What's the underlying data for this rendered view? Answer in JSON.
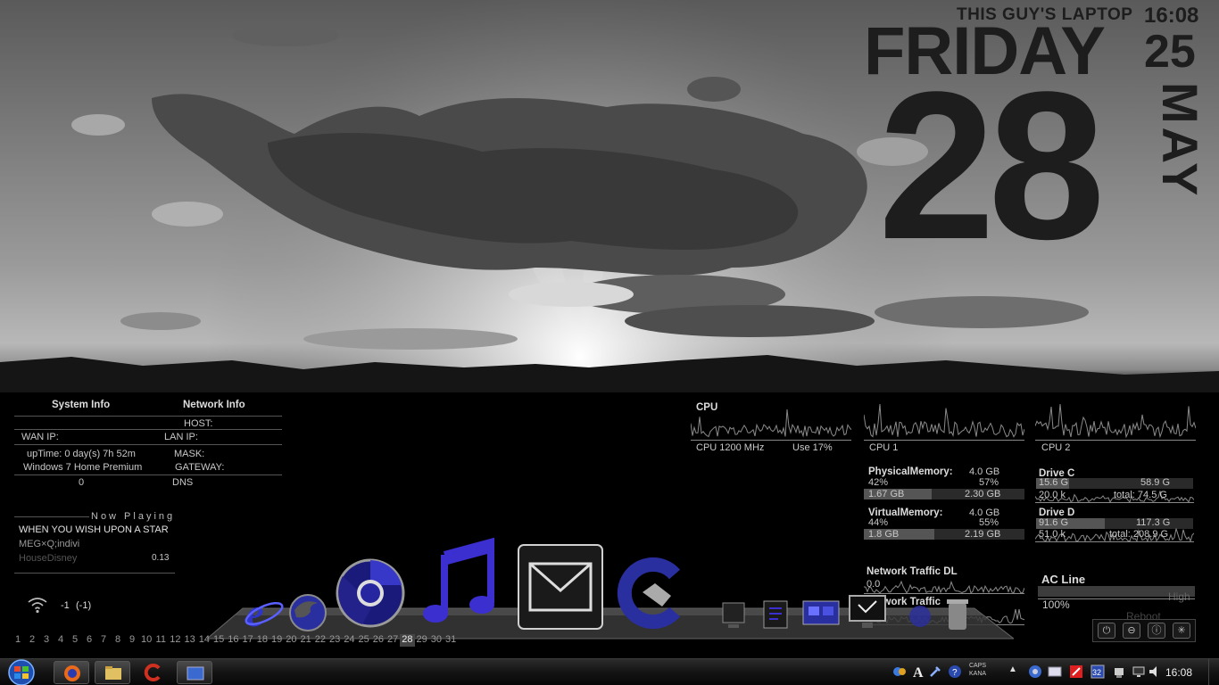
{
  "clock": {
    "owner": "THIS GUY'S LAPTOP",
    "time": "16:08",
    "dayname": "FRIDAY",
    "daynum_small": "25",
    "daynum": "28",
    "month": "MAY"
  },
  "system_info": {
    "title": "System Info",
    "wan_ip_label": "WAN IP:",
    "uptime": "upTime: 0 day(s) 7h 52m",
    "os": "Windows 7 Home Premium",
    "value_zero": "0"
  },
  "network_info": {
    "title": "Network Info",
    "host_label": "HOST:",
    "lan_ip_label": "LAN IP:",
    "mask_label": "MASK:",
    "gateway_label": "GATEWAY:",
    "dns_label": "DNS"
  },
  "now_playing": {
    "title": "Now Playing",
    "track": "WHEN YOU WISH UPON A STAR",
    "artist": "MEG×Q;indivi",
    "album": "HouseDisney",
    "position": "0.13"
  },
  "wifi": {
    "icon": "wifi-icon",
    "signal": "-1",
    "signal_paren": "(-1)"
  },
  "cpu": {
    "title": "CPU",
    "freq": "CPU 1200 MHz",
    "use": "Use 17%",
    "core1": "CPU 1",
    "core2": "CPU 2"
  },
  "physical_memory": {
    "label": "PhysicalMemory:",
    "total": "4.0 GB",
    "pct_used": "42%",
    "pct_free": "57%",
    "used": "1.67 GB",
    "free": "2.30 GB",
    "fill": 0.42
  },
  "virtual_memory": {
    "label": "VirtualMemory:",
    "total": "4.0 GB",
    "pct_used": "44%",
    "pct_free": "55%",
    "used": "1.8 GB",
    "free": "2.19 GB",
    "fill": 0.44
  },
  "drive_c": {
    "label": "Drive C",
    "used": "15.6 G",
    "free": "58.9 G",
    "activity": "20.0 k",
    "total": "total: 74.5 G",
    "fill": 0.21
  },
  "drive_d": {
    "label": "Drive D",
    "used": "91.6 G",
    "free": "117.3 G",
    "activity": "51.0 k",
    "total": "total: 208.9 G",
    "fill": 0.44
  },
  "network_traffic": {
    "dl_label": "Network Traffic DL",
    "dl_value": "0.0",
    "ul_label": "Network Traffic"
  },
  "power": {
    "label": "AC Line",
    "level": "High",
    "percent": "100%",
    "fill": 1.0,
    "reboot_label": "Reboot"
  },
  "calendar": {
    "days": [
      "1",
      "2",
      "3",
      "4",
      "5",
      "6",
      "7",
      "8",
      "9",
      "10",
      "11",
      "12",
      "13",
      "14",
      "15",
      "16",
      "17",
      "18",
      "19",
      "20",
      "21",
      "22",
      "23",
      "24",
      "25",
      "26",
      "27",
      "28",
      "29",
      "30",
      "31"
    ],
    "today": "28"
  },
  "taskbar": {
    "caps": "CAPS",
    "kana": "KANA",
    "time": "16:08"
  },
  "colors": {
    "dock_accent": "#3b2fd0",
    "widget_text": "#1d1d1d"
  }
}
